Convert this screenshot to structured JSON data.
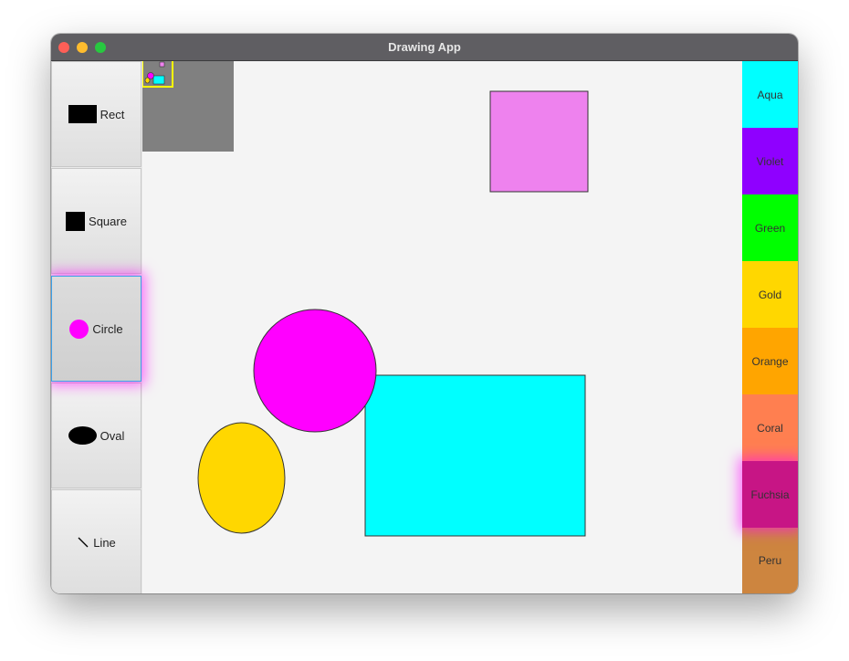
{
  "window": {
    "title": "Drawing App"
  },
  "tools": [
    {
      "id": "rect",
      "label": "Rect",
      "icon": "rectangle-icon"
    },
    {
      "id": "square",
      "label": "Square",
      "icon": "square-icon"
    },
    {
      "id": "circle",
      "label": "Circle",
      "icon": "circle-icon",
      "active": true
    },
    {
      "id": "oval",
      "label": "Oval",
      "icon": "oval-icon"
    },
    {
      "id": "line",
      "label": "Line",
      "icon": "line-icon"
    }
  ],
  "palette": [
    {
      "label": "Aqua",
      "color": "#00ffff"
    },
    {
      "label": "Violet",
      "color": "#8f00ff"
    },
    {
      "label": "Green",
      "color": "#00ff00"
    },
    {
      "label": "Gold",
      "color": "#ffd700"
    },
    {
      "label": "Orange",
      "color": "#ffa500"
    },
    {
      "label": "Coral",
      "color": "#ff7f50"
    },
    {
      "label": "Fuchsia",
      "color": "#c71585",
      "active": true
    },
    {
      "label": "Peru",
      "color": "#cd853f"
    }
  ],
  "colors": {
    "minimap_bg": "#808080",
    "minimap_viewport": "#ffff00"
  },
  "canvas_shapes": [
    {
      "type": "square",
      "fill": "#ee82ee"
    },
    {
      "type": "rectangle",
      "fill": "#00ffff"
    },
    {
      "type": "circle",
      "fill": "#ff00ff"
    },
    {
      "type": "oval",
      "fill": "#ffd700"
    }
  ]
}
